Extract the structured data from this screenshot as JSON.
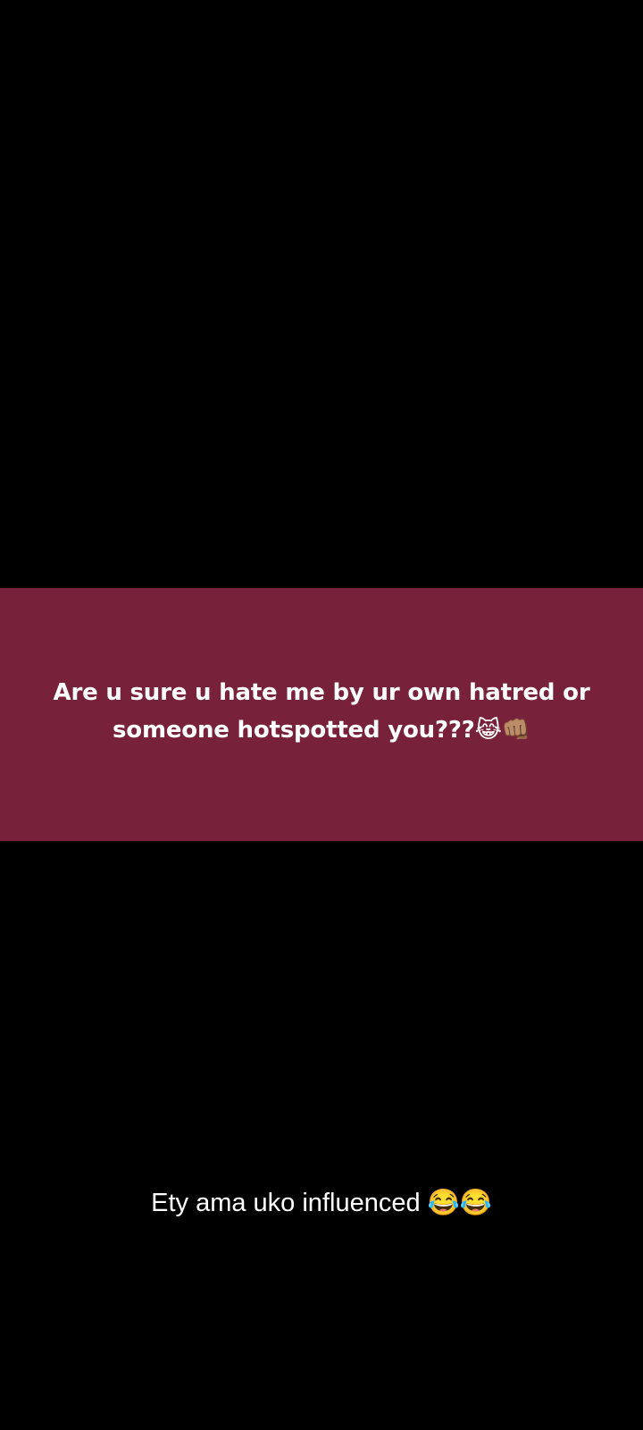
{
  "post": {
    "text": "Are u sure u hate me by ur own hatred or someone hotspotted you???😹👊🏽",
    "background_color": "#78213A",
    "text_color": "#FFFFFF"
  },
  "caption": {
    "text": "Ety ama uko influenced 😂😂"
  },
  "screen": {
    "background_color": "#000000"
  }
}
